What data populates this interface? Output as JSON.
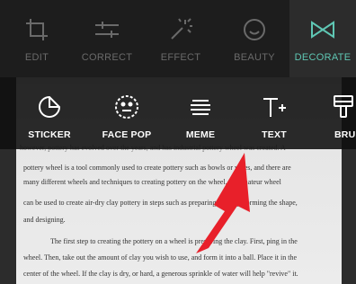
{
  "toolbar": {
    "items": [
      {
        "label": "EDIT",
        "icon": "crop-icon"
      },
      {
        "label": "CORRECT",
        "icon": "sliders-icon"
      },
      {
        "label": "EFFECT",
        "icon": "magic-wand-icon"
      },
      {
        "label": "BEAUTY",
        "icon": "smiley-icon"
      },
      {
        "label": "DECORATE",
        "icon": "bowtie-icon"
      }
    ],
    "active": "DECORATE",
    "active_color": "#5fc7b4"
  },
  "subtoolbar": {
    "items": [
      {
        "label": "STICKER",
        "icon": "sticker-icon"
      },
      {
        "label": "FACE POP",
        "icon": "face-pop-icon"
      },
      {
        "label": "MEME",
        "icon": "meme-icon"
      },
      {
        "label": "TEXT",
        "icon": "text-add-icon"
      },
      {
        "label": "BRU",
        "icon": "brush-icon"
      }
    ]
  },
  "document": {
    "lines": [
      "however, pottery has evolved over the years, and has industrial pottery wheel was created. A",
      "pottery wheel is a tool commonly used to create pottery such as bowls or vases, and there are",
      "many different wheels and techniques to creating pottery on the wheel. An amateur wheel",
      "can be used to create air-dry clay pottery in steps such as preparing the clay, forming the shape,",
      "and designing.",
      "The first step to creating the pottery on a wheel is preparing the clay. First, ping in the",
      "wheel. Then, take out the amount of clay you wish to use, and form it into a ball. Place it in the",
      "center of the wheel. If the clay is dry, or hard, a generous sprinkle of water will help \"revive\" it."
    ]
  },
  "annotation": {
    "arrow_color": "#e8202a"
  }
}
